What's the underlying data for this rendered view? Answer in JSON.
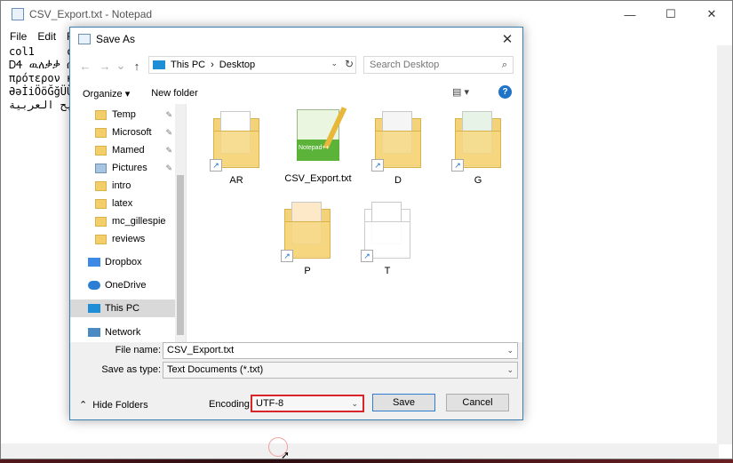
{
  "notepad": {
    "title": "CSV_Export.txt - Notepad",
    "controls": {
      "minimize": "—",
      "maximize": "☐",
      "close": "✕"
    },
    "menu": [
      "File",
      "Edit",
      "Fo"
    ],
    "lines": [
      "col1     co",
      "ᎠᏎ ዉለቃቃ በ",
      "πρότερον κ",
      "ƏəİiÖöĞğÜÜ",
      "لمفاتيح العربية"
    ]
  },
  "dialog": {
    "title": "Save As",
    "close": "✕",
    "nav": {
      "back": "←",
      "forward": "→",
      "dropdown": "⌄",
      "up": "↑"
    },
    "breadcrumb": [
      "This PC",
      "›",
      "Desktop"
    ],
    "addr_dropdown": "⌄",
    "refresh": "↻",
    "search_placeholder": "Search Desktop",
    "search_icon": "⌕",
    "toolbar": {
      "organize": "Organize ▾",
      "new_folder": "New folder",
      "view": "▤ ▾",
      "help": "?"
    },
    "sidebar": [
      {
        "label": "Temp",
        "pinned": true
      },
      {
        "label": "Microsoft",
        "pinned": true
      },
      {
        "label": "Mamed",
        "pinned": true
      },
      {
        "label": "Pictures",
        "pinned": true
      },
      {
        "label": "intro",
        "pinned": false
      },
      {
        "label": "latex",
        "pinned": false
      },
      {
        "label": "mc_gillespie",
        "pinned": false
      },
      {
        "label": "reviews",
        "pinned": false
      },
      {
        "label": "Dropbox",
        "pinned": false
      },
      {
        "label": "OneDrive",
        "pinned": false
      },
      {
        "label": "This PC",
        "pinned": false
      },
      {
        "label": "Network",
        "pinned": false
      }
    ],
    "pin_icon": "✎",
    "files": [
      "AR",
      "CSV_Export.txt",
      "D",
      "G",
      "P",
      "T"
    ],
    "shortcut_arrow": "↗",
    "npp_logo": "Notepad++",
    "file_name_label": "File name:",
    "file_name_value": "CSV_Export.txt",
    "save_type_label": "Save as type:",
    "save_type_value": "Text Documents (*.txt)",
    "dd_arrow": "⌄",
    "hide_folders": "Hide Folders",
    "hide_folders_icon": "⌃",
    "encoding_label": "Encoding:",
    "encoding_value": "UTF-8",
    "save_button": "Save",
    "cancel_button": "Cancel"
  },
  "colors": {
    "accent": "#1f73c9",
    "highlight": "#d9242b"
  },
  "cursor": "➚"
}
